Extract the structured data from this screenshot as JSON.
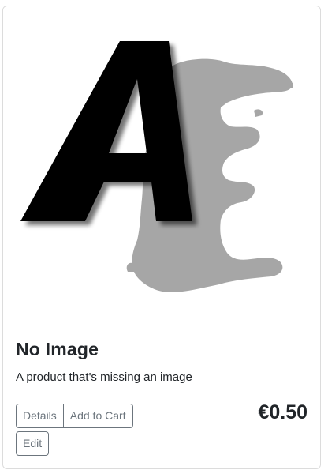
{
  "product": {
    "logo_text": "AE",
    "title": "No Image",
    "description": "A product that's missing an image",
    "price": "€0.50"
  },
  "actions": {
    "details_label": "Details",
    "add_to_cart_label": "Add to Cart",
    "edit_label": "Edit"
  },
  "colors": {
    "logo_letter": "#000000",
    "logo_splash": "#a6a6a6",
    "button_outline": "#6c757d"
  }
}
